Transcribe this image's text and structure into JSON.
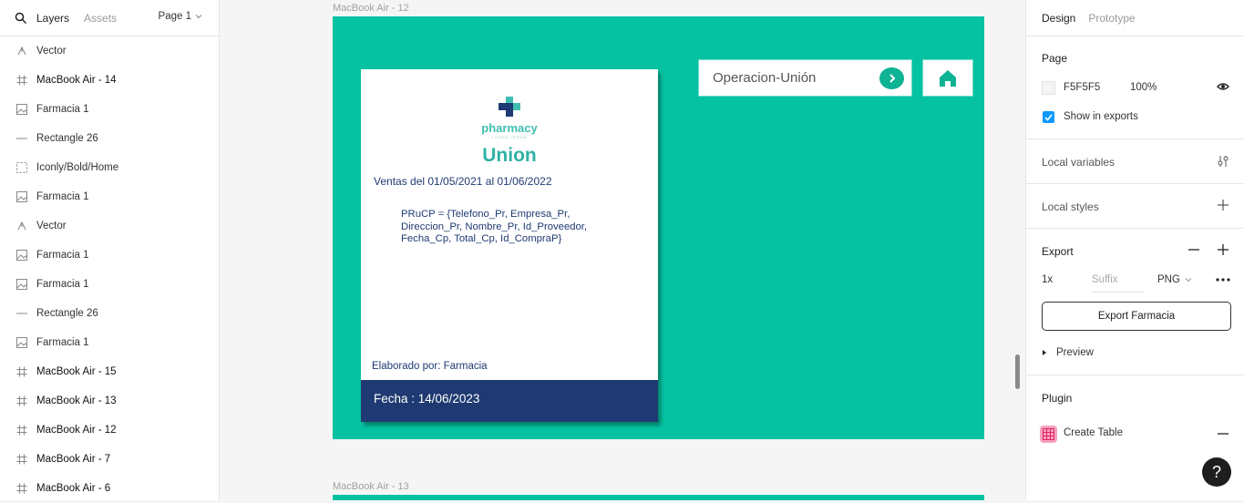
{
  "left_panel": {
    "tabs": [
      "Layers",
      "Assets"
    ],
    "page_selector": "Page 1",
    "layers": [
      {
        "label": "Vector",
        "icon": "vector-icon"
      },
      {
        "label": "MacBook Air - 14",
        "icon": "frame-icon"
      },
      {
        "label": "Farmacia 1",
        "icon": "image-icon"
      },
      {
        "label": "Rectangle 26",
        "icon": "line-icon"
      },
      {
        "label": "Iconly/Bold/Home",
        "icon": "component-icon"
      },
      {
        "label": "Farmacia 1",
        "icon": "image-icon"
      },
      {
        "label": "Vector",
        "icon": "vector-icon"
      },
      {
        "label": "Farmacia 1",
        "icon": "image-icon"
      },
      {
        "label": "Farmacia 1",
        "icon": "image-icon"
      },
      {
        "label": "Rectangle 26",
        "icon": "line-icon"
      },
      {
        "label": "Farmacia 1",
        "icon": "image-icon"
      },
      {
        "label": "MacBook Air - 15",
        "icon": "frame-icon"
      },
      {
        "label": "MacBook Air - 13",
        "icon": "frame-icon"
      },
      {
        "label": "MacBook Air - 12",
        "icon": "frame-icon"
      },
      {
        "label": "MacBook Air - 7",
        "icon": "frame-icon"
      },
      {
        "label": "MacBook Air - 6",
        "icon": "frame-icon"
      }
    ]
  },
  "canvas": {
    "frame1_label": "MacBook Air - 12",
    "frame2_label": "MacBook Air - 13",
    "doc": {
      "brand": "pharmacy",
      "tagline": "LOREM IPSUM",
      "title": "Union",
      "subtitle": "Ventas del 01/05/2021 al 01/06/2022",
      "formula": "PRuCP = {Telefono_Pr, Empresa_Pr, Direccion_Pr, Nombre_Pr, Id_Proveedor, Fecha_Cp, Total_Cp, Id_CompraP}",
      "elaborado": "Elaborado por: Farmacia",
      "fecha": "Fecha : 14/06/2023"
    },
    "operation_label": "Operacion-Unión"
  },
  "right_panel": {
    "tabs": [
      "Design",
      "Prototype"
    ],
    "page_section": "Page",
    "page_color": "F5F5F5",
    "page_opacity": "100%",
    "show_in_exports": "Show in exports",
    "local_variables": "Local variables",
    "local_styles": "Local styles",
    "export_section": "Export",
    "export_scale": "1x",
    "export_suffix_placeholder": "Suffix",
    "export_format": "PNG",
    "export_button": "Export Farmacia",
    "preview": "Preview",
    "plugin_section": "Plugin",
    "plugin_name": "Create Table",
    "help": "?"
  },
  "colors": {
    "frame_bg": "#05C2A2",
    "doc_navy": "#1F3A72",
    "accent_blue": "#0D99FF"
  }
}
